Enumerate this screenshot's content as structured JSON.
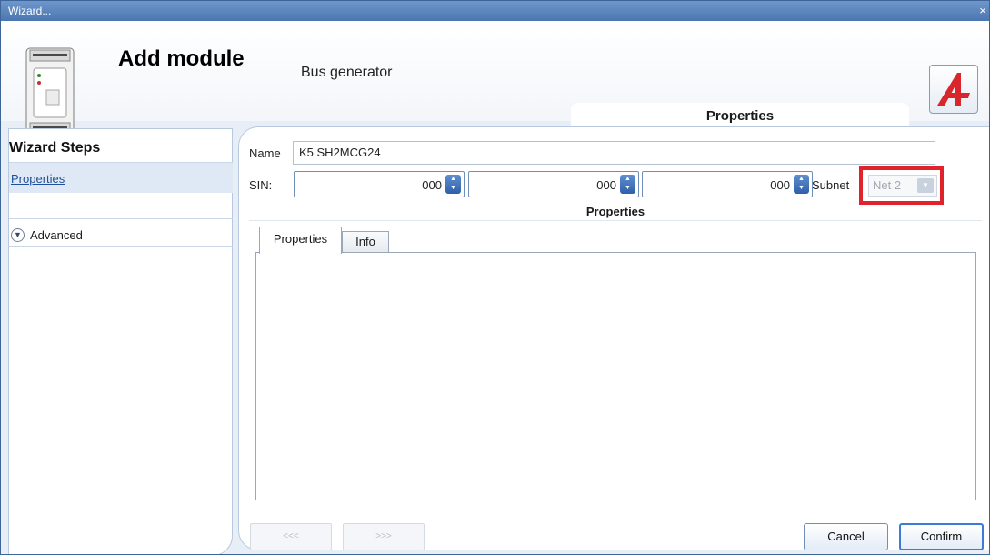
{
  "window": {
    "title": "Wizard...",
    "close_glyph": "×"
  },
  "header": {
    "title": "Add module",
    "subtitle": "Bus generator",
    "module_icon": "din-rail-module-icon",
    "logo_icon": "app-logo-icon"
  },
  "panel_tab": {
    "label": "Properties"
  },
  "sidebar": {
    "title": "Wizard Steps",
    "steps": [
      {
        "label": "Properties",
        "active": true
      }
    ],
    "advanced": {
      "label": "Advanced",
      "icon": "chevron-down-circle-icon"
    }
  },
  "form": {
    "name_label": "Name",
    "name_value": "K5 SH2MCG24",
    "sin_label": "SIN:",
    "sin_values": [
      "000",
      "000",
      "000"
    ],
    "subnet_label": "Subnet",
    "subnet_value": "Net 2",
    "subnet_enabled": false,
    "highlight_color": "#e0232a"
  },
  "section": {
    "title": "Properties"
  },
  "tabs": [
    {
      "label": "Properties",
      "active": true
    },
    {
      "label": "Info",
      "active": false
    }
  ],
  "footer": {
    "prev_label": "<<<",
    "next_label": ">>>",
    "cancel_label": "Cancel",
    "confirm_label": "Confirm"
  }
}
